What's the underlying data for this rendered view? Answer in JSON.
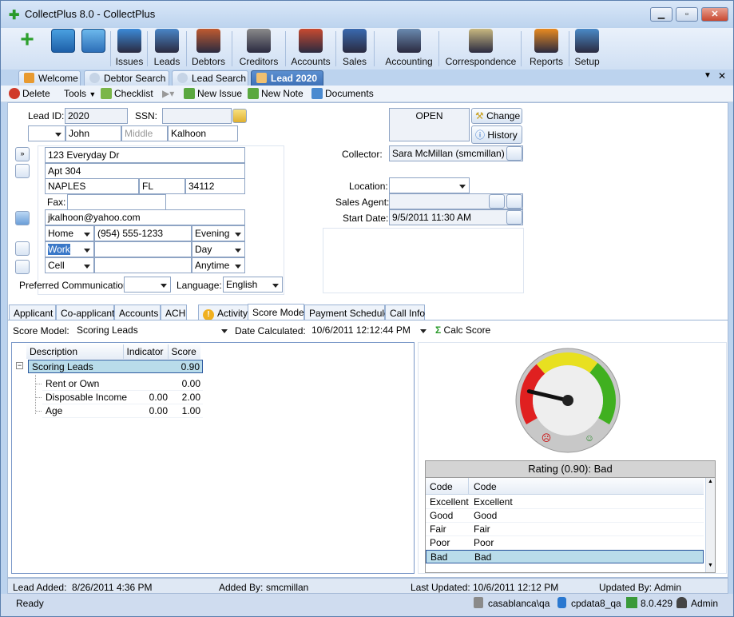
{
  "window": {
    "title": "CollectPlus 8.0 - CollectPlus"
  },
  "ribbon": [
    {
      "label": "Issues",
      "icon": "issues-icon"
    },
    {
      "label": "Leads",
      "icon": "leads-icon"
    },
    {
      "label": "Debtors",
      "icon": "debtors-icon"
    },
    {
      "label": "Creditors",
      "icon": "creditors-icon"
    },
    {
      "label": "Accounts",
      "icon": "accounts-icon"
    },
    {
      "label": "Sales",
      "icon": "sales-icon"
    },
    {
      "label": "Accounting",
      "icon": "accounting-icon"
    },
    {
      "label": "Correspondence",
      "icon": "correspondence-icon"
    },
    {
      "label": "Reports",
      "icon": "reports-icon"
    },
    {
      "label": "Setup",
      "icon": "setup-icon"
    }
  ],
  "doc_tabs": [
    "Welcome",
    "Debtor Search",
    "Lead Search",
    "Lead 2020"
  ],
  "toolbar": {
    "delete": "Delete",
    "tools": "Tools",
    "checklist": "Checklist",
    "new_issue": "New Issue",
    "new_note": "New Note",
    "documents": "Documents"
  },
  "lead": {
    "lead_id_label": "Lead ID:",
    "lead_id": "2020",
    "ssn_label": "SSN:",
    "ssn": "",
    "first": "John",
    "middle": "Middle",
    "last": "Kalhoon",
    "addr1": "123 Everyday Dr",
    "addr2": "Apt 304",
    "city": "NAPLES",
    "state": "FL",
    "zip": "34112",
    "fax_label": "Fax:",
    "email": "jkalhoon@yahoo.com",
    "phones": [
      {
        "type": "Home",
        "number": "(954) 555-1233",
        "time": "Evening"
      },
      {
        "type": "Work",
        "number": "",
        "time": "Day"
      },
      {
        "type": "Cell",
        "number": "",
        "time": "Anytime"
      }
    ],
    "pref_comm_label": "Preferred Communication:",
    "language_label": "Language:",
    "language": "English",
    "status": "OPEN",
    "change": "Change",
    "history": "History",
    "collector_label": "Collector:",
    "collector": "Sara McMillan (smcmillan)",
    "location_label": "Location:",
    "sales_agent_label": "Sales Agent:",
    "start_date_label": "Start Date:",
    "start_date": "9/5/2011 11:30 AM"
  },
  "content_tabs": [
    "Applicant",
    "Co-applicants",
    "Accounts",
    "ACH",
    "Activity",
    "Score Model",
    "Payment Schedule",
    "Call Info"
  ],
  "score": {
    "model_label": "Score Model:",
    "model": "Scoring Leads",
    "date_label": "Date Calculated:",
    "date": "10/6/2011 12:12:44 PM",
    "calc": "Calc Score",
    "columns": [
      "Description",
      "Indicator",
      "Score"
    ],
    "root": {
      "description": "Scoring Leads",
      "score": "0.90"
    },
    "rows": [
      {
        "description": "Rent or Own",
        "indicator": "",
        "score": "0.00"
      },
      {
        "description": "Disposable Income",
        "indicator": "0.00",
        "score": "2.00"
      },
      {
        "description": "Age",
        "indicator": "0.00",
        "score": "1.00"
      }
    ],
    "gauge_value": 0.9,
    "rating_title": "Rating (0.90): Bad",
    "rating_columns": [
      "Code",
      "Code"
    ],
    "ratings": [
      {
        "a": "Excellent",
        "b": "Excellent"
      },
      {
        "a": "Good",
        "b": "Good"
      },
      {
        "a": "Fair",
        "b": "Fair"
      },
      {
        "a": "Poor",
        "b": "Poor"
      },
      {
        "a": "Bad",
        "b": "Bad"
      }
    ]
  },
  "footer": {
    "lead_added_label": "Lead Added:",
    "lead_added": "8/26/2011 4:36 PM",
    "added_by_label": "Added By:",
    "added_by": "smcmillan",
    "last_updated_label": "Last Updated:",
    "last_updated": "10/6/2011 12:12 PM",
    "updated_by_label": "Updated By:",
    "updated_by": "Admin"
  },
  "status": {
    "ready": "Ready",
    "server": "casablanca\\qa",
    "db": "cpdata8_qa",
    "version": "8.0.429",
    "user": "Admin"
  },
  "colors": {
    "titlebar": "#bcd3ee",
    "active_tab": "#3f72b8",
    "gauge_red": "#e02020",
    "gauge_yellow": "#e8e020",
    "gauge_green": "#40b020",
    "selected_row": "#b9dcea"
  }
}
